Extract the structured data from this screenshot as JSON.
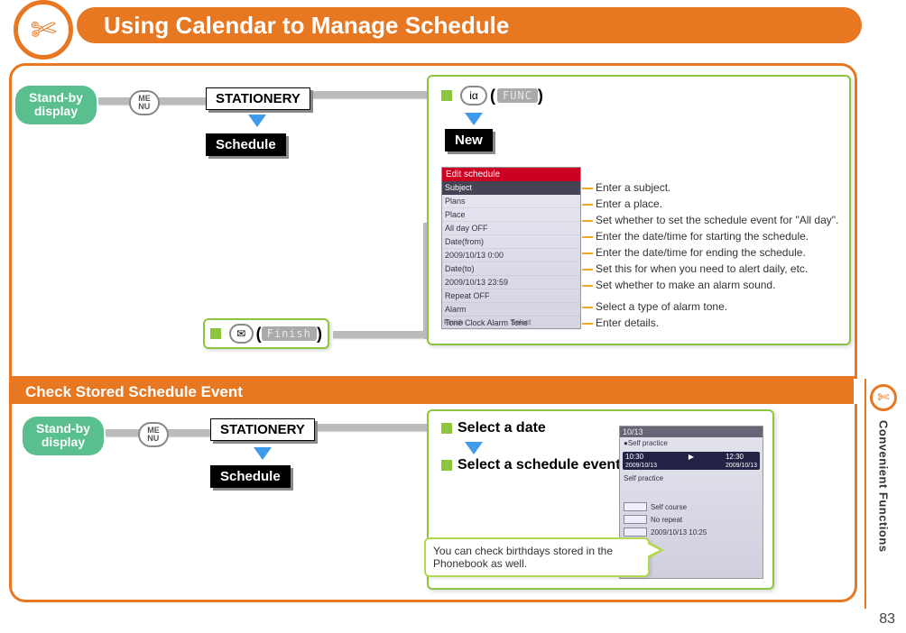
{
  "title": "Using Calendar to Manage Schedule",
  "side_tab": "Convenient Functions",
  "page_number": "83",
  "standby_label": "Stand-by display",
  "menu_key": "ME\nNU",
  "stationery_label": "STATIONERY",
  "schedule_label": "Schedule",
  "func_label": "FUNC",
  "new_label": "New",
  "finish_label": "Finish",
  "edit_header": "Edit schedule",
  "phone_rows": {
    "r1": "Subject",
    "r2": "Plans",
    "r3": "Place",
    "r4": "All day               OFF",
    "r5": "Date(from)",
    "r6": " 2009/10/13  0:00",
    "r7": "Date(to)",
    "r8": " 2009/10/13 23:59",
    "r9": "Repeat               OFF",
    "r10": "Alarm",
    "r11": "Tone  Clock Alarm Tone",
    "r12": "Detail"
  },
  "phone_foot": {
    "l": "Finish",
    "c": "Select",
    "r": ""
  },
  "desc": {
    "d1": "Enter a subject.",
    "d2": "Enter a place.",
    "d3": "Set whether to set the schedule event for \"All day\".",
    "d4": "Enter the date/time for starting the schedule.",
    "d5": "Enter the date/time for ending the schedule.",
    "d6": "Set this for when you need to alert daily, etc.",
    "d7": "Set whether to make an alarm sound.",
    "d8": "Select a type of alarm tone.",
    "d9": "Enter details."
  },
  "section2_header": "Check Stored Schedule Event",
  "select_date": "Select a date",
  "select_event": "Select a schedule event.",
  "callout": "You can check birthdays stored in the Phonebook as well.",
  "phone2": {
    "hdr": "10/13",
    "chip": "Self practice",
    "t1": "10:30",
    "d1": "2009/10/13",
    "t2": "12:30",
    "d2": "2009/10/13",
    "sub": "Self practice",
    "l1": "Self course",
    "l2": "No repeat",
    "l3": "2009/10/13 10:25"
  }
}
